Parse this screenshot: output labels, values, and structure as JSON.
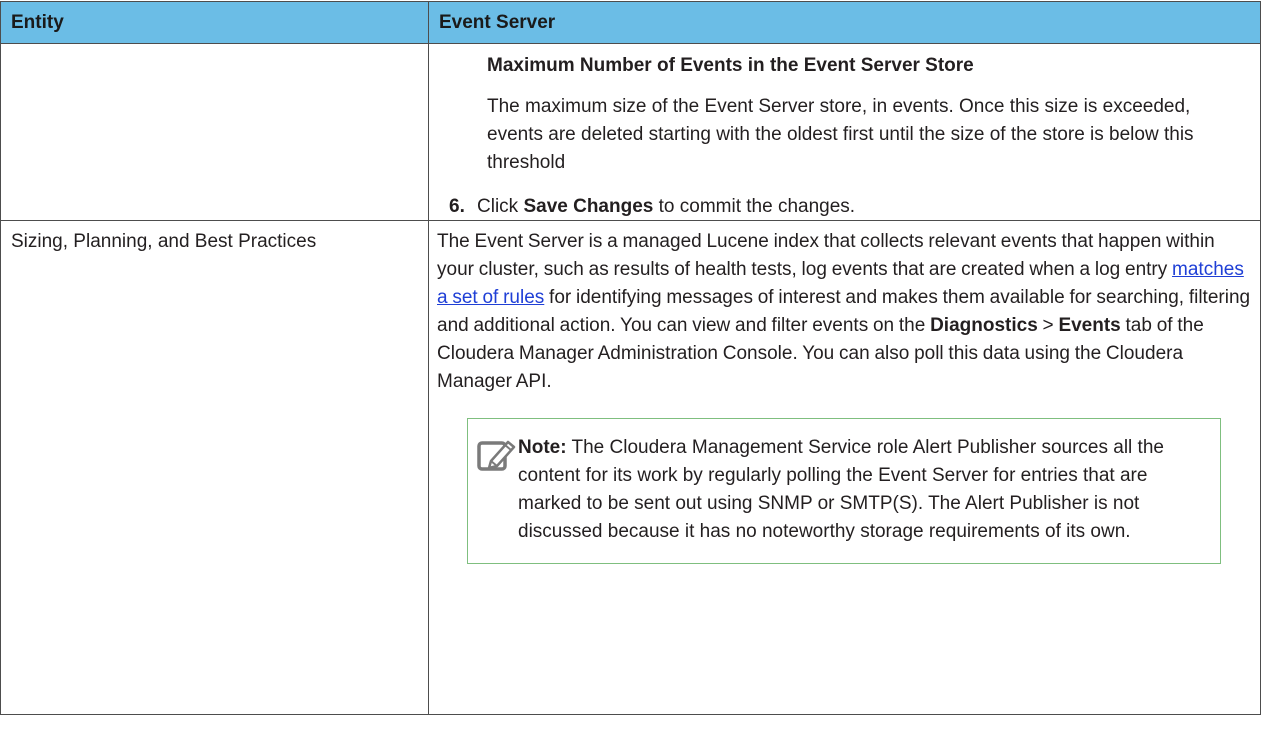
{
  "table": {
    "headers": [
      "Entity",
      "Event Server"
    ],
    "row1": {
      "entity": "",
      "detail_title": "Maximum Number of Events in the Event Server Store",
      "detail_text": "The maximum size of the Event Server store, in events. Once this size is exceeded, events are deleted starting with the oldest first until the size of the store is below this threshold",
      "step_number": "6.",
      "step_pre": "Click ",
      "step_bold": "Save Changes",
      "step_post": " to commit the changes."
    },
    "row2": {
      "entity": "Sizing, Planning, and Best Practices",
      "para_1": "The Event Server is a managed Lucene index that collects relevant events that happen within your cluster, such as results of health tests, log events that are created when a log entry ",
      "link_text": "matches a set of rules",
      "para_2": " for identifying messages of interest and makes them available for searching, filtering and additional action. You can view and filter events on the ",
      "bold_1": "Diagnostics",
      "sep": " > ",
      "bold_2": "Events",
      "para_3": " tab of the Cloudera Manager Administration Console. You can also poll this data using the Cloudera Manager API.",
      "note_label": "Note:",
      "note_text": " The Cloudera Management Service role Alert Publisher sources all the content for its work by regularly polling the Event Server for entries that are marked to be sent out using SNMP or SMTP(S). The Alert Publisher is not discussed because it has no noteworthy storage requirements of its own."
    }
  },
  "colors": {
    "header_bg": "#6bbde6",
    "link": "#1f3fd6",
    "note_border": "#7fbf7f"
  },
  "icons": {
    "note": "note-pencil-icon"
  }
}
